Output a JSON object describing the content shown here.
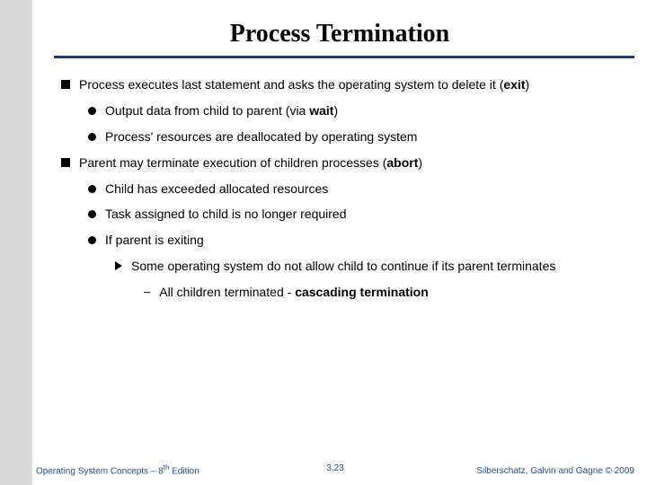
{
  "title": "Process Termination",
  "bullets": {
    "a": "Process executes last statement and asks the operating system to delete it (",
    "a_b": "exit",
    "a_end": ")",
    "a1": "Output data from child to parent (via ",
    "a1_b": "wait",
    "a1_end": ")",
    "a2": "Process' resources are deallocated by operating system",
    "b": "Parent may terminate execution of children processes (",
    "b_b": "abort",
    "b_end": ")",
    "b1": "Child has exceeded allocated resources",
    "b2": "Task assigned to child is no longer required",
    "b3": "If parent is exiting",
    "b3a": "Some operating system do not allow child to continue if its parent terminates",
    "b3a1_pre": "All children terminated - ",
    "b3a1_b": "cascading termination"
  },
  "footer": {
    "left_a": "Operating System Concepts – 8",
    "left_sup": "th",
    "left_b": " Edition",
    "center": "3.23",
    "right": "Silberschatz, Galvin and Gagne © 2009"
  }
}
